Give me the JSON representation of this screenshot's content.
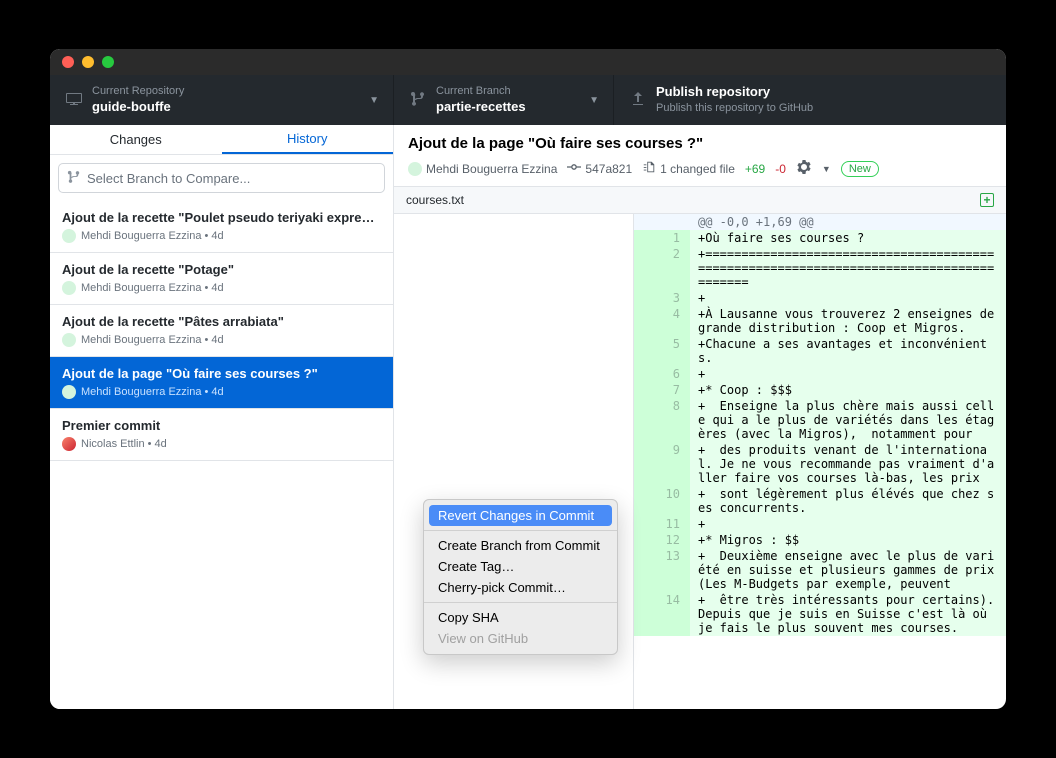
{
  "toolbar": {
    "repo": {
      "label": "Current Repository",
      "value": "guide-bouffe"
    },
    "branch": {
      "label": "Current Branch",
      "value": "partie-recettes"
    },
    "publish": {
      "label": "Publish repository",
      "sub": "Publish this repository to GitHub"
    }
  },
  "tabs": {
    "changes": "Changes",
    "history": "History"
  },
  "branch_select_placeholder": "Select Branch to Compare...",
  "commits": [
    {
      "title": "Ajout de la recette \"Poulet pseudo teriyaki express\"",
      "author": "Mehdi Bouguerra Ezzina",
      "time": "4d",
      "selected": false,
      "avatar": "green"
    },
    {
      "title": "Ajout de la recette \"Potage\"",
      "author": "Mehdi Bouguerra Ezzina",
      "time": "4d",
      "selected": false,
      "avatar": "green"
    },
    {
      "title": "Ajout de la recette \"Pâtes arrabiata\"",
      "author": "Mehdi Bouguerra Ezzina",
      "time": "4d",
      "selected": false,
      "avatar": "green"
    },
    {
      "title": "Ajout de la page \"Où faire ses courses ?\"",
      "author": "Mehdi Bouguerra Ezzina",
      "time": "4d",
      "selected": true,
      "avatar": "green"
    },
    {
      "title": "Premier commit",
      "author": "Nicolas Ettlin",
      "time": "4d",
      "selected": false,
      "avatar": "orange"
    }
  ],
  "commit_header": {
    "title": "Ajout de la page \"Où faire ses courses ?\"",
    "author": "Mehdi Bouguerra Ezzina",
    "sha": "547a821",
    "changed_files": "1 changed file",
    "additions": "+69",
    "deletions": "-0",
    "new_badge": "New"
  },
  "file": {
    "name": "courses.txt"
  },
  "diff": {
    "hunk": "@@ -0,0 +1,69 @@",
    "lines": [
      {
        "n": "1",
        "t": "+Où faire ses courses ?"
      },
      {
        "n": "2",
        "t": "+========================================================================================"
      },
      {
        "n": "3",
        "t": "+"
      },
      {
        "n": "4",
        "t": "+À Lausanne vous trouverez 2 enseignes de grande distribution : Coop et Migros."
      },
      {
        "n": "5",
        "t": "+Chacune a ses avantages et inconvénients."
      },
      {
        "n": "6",
        "t": "+"
      },
      {
        "n": "7",
        "t": "+* Coop : $$$"
      },
      {
        "n": "8",
        "t": "+  Enseigne la plus chère mais aussi celle qui a le plus de variétés dans les étagères (avec la Migros),  notamment pour"
      },
      {
        "n": "9",
        "t": "+  des produits venant de l'international. Je ne vous recommande pas vraiment d'aller faire vos courses là-bas, les prix"
      },
      {
        "n": "10",
        "t": "+  sont légèrement plus élévés que chez ses concurrents."
      },
      {
        "n": "11",
        "t": "+"
      },
      {
        "n": "12",
        "t": "+* Migros : $$"
      },
      {
        "n": "13",
        "t": "+  Deuxième enseigne avec le plus de variété en suisse et plusieurs gammes de prix (Les M-Budgets par exemple, peuvent"
      },
      {
        "n": "14",
        "t": "+  être très intéressants pour certains). Depuis que je suis en Suisse c'est là où je fais le plus souvent mes courses."
      }
    ]
  },
  "context_menu": {
    "items": [
      {
        "label": "Revert Changes in Commit",
        "state": "highlighted"
      },
      {
        "sep": true
      },
      {
        "label": "Create Branch from Commit",
        "state": "normal"
      },
      {
        "label": "Create Tag…",
        "state": "normal"
      },
      {
        "label": "Cherry-pick Commit…",
        "state": "normal"
      },
      {
        "sep": true
      },
      {
        "label": "Copy SHA",
        "state": "normal"
      },
      {
        "label": "View on GitHub",
        "state": "disabled"
      }
    ]
  }
}
